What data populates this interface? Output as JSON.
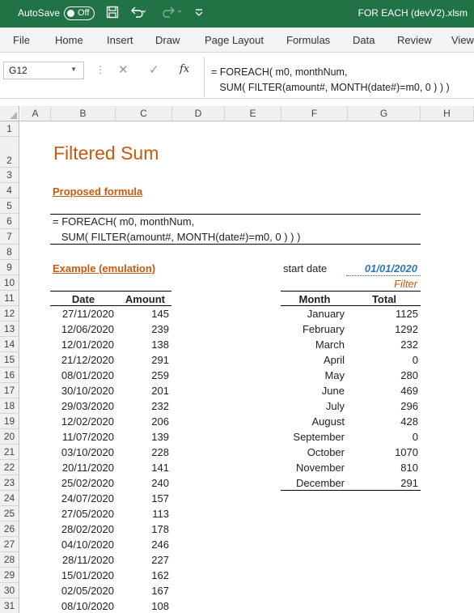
{
  "titlebar": {
    "autosave_label": "AutoSave",
    "toggle_state": "Off",
    "filename": "FOR EACH (devV2).xlsm"
  },
  "ribbon": {
    "tabs": [
      "File",
      "Home",
      "Insert",
      "Draw",
      "Page Layout",
      "Formulas",
      "Data",
      "Review",
      "View"
    ]
  },
  "formula_bar": {
    "name_box": "G12",
    "fx_label": "fx",
    "formula": "= FOREACH( m0, monthNum,\n   SUM( FILTER(amount#, MONTH(date#)=m0, 0 ) ) )"
  },
  "columns": [
    "A",
    "B",
    "C",
    "D",
    "E",
    "F",
    "G",
    "H"
  ],
  "rows": [
    "1",
    "2",
    "3",
    "4",
    "5",
    "6",
    "7",
    "8",
    "9",
    "10",
    "11",
    "12",
    "13",
    "14",
    "15",
    "16",
    "17",
    "18",
    "19",
    "20",
    "21",
    "22",
    "23",
    "24",
    "25",
    "26",
    "27",
    "28",
    "29",
    "30",
    "31"
  ],
  "sheet": {
    "title": "Filtered Sum",
    "proposed_label": "Proposed formula",
    "formula_line1": "= FOREACH( m0, monthNum,",
    "formula_line2": "   SUM( FILTER(amount#, MONTH(date#)=m0, 0 ) ) )",
    "example_label": "Example (emulation)",
    "start_date_label": "start date",
    "start_date_value": "01/01/2020",
    "filter_label": "Filter",
    "left_table": {
      "headers": [
        "Date",
        "Amount"
      ],
      "rows": [
        [
          "27/11/2020",
          "145"
        ],
        [
          "12/06/2020",
          "239"
        ],
        [
          "12/01/2020",
          "138"
        ],
        [
          "21/12/2020",
          "291"
        ],
        [
          "08/01/2020",
          "259"
        ],
        [
          "30/10/2020",
          "201"
        ],
        [
          "29/03/2020",
          "232"
        ],
        [
          "12/02/2020",
          "206"
        ],
        [
          "11/07/2020",
          "139"
        ],
        [
          "03/10/2020",
          "228"
        ],
        [
          "20/11/2020",
          "141"
        ],
        [
          "25/02/2020",
          "240"
        ],
        [
          "24/07/2020",
          "157"
        ],
        [
          "27/05/2020",
          "113"
        ],
        [
          "28/02/2020",
          "178"
        ],
        [
          "04/10/2020",
          "246"
        ],
        [
          "28/11/2020",
          "227"
        ],
        [
          "15/01/2020",
          "162"
        ],
        [
          "02/05/2020",
          "167"
        ],
        [
          "08/10/2020",
          "108"
        ]
      ]
    },
    "right_table": {
      "headers": [
        "Month",
        "Total"
      ],
      "rows": [
        [
          "January",
          "1125"
        ],
        [
          "February",
          "1292"
        ],
        [
          "March",
          "232"
        ],
        [
          "April",
          "0"
        ],
        [
          "May",
          "280"
        ],
        [
          "June",
          "469"
        ],
        [
          "July",
          "296"
        ],
        [
          "August",
          "428"
        ],
        [
          "September",
          "0"
        ],
        [
          "October",
          "1070"
        ],
        [
          "November",
          "810"
        ],
        [
          "December",
          "291"
        ]
      ]
    }
  },
  "colors": {
    "excel_green": "#217346",
    "accent_orange": "#c55a11",
    "input_blue": "#2e75b6"
  }
}
